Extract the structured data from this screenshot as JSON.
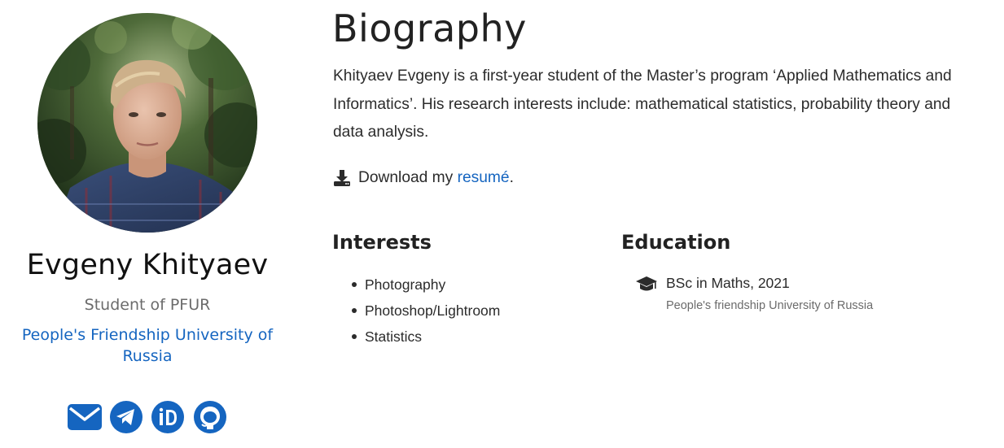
{
  "profile": {
    "name": "Evgeny Khityaev",
    "role": "Student of PFUR",
    "organization": "People's Friendship University of Russia",
    "avatar_icon": "profile-photo",
    "social": [
      {
        "icon": "envelope-icon",
        "label": "email"
      },
      {
        "icon": "telegram-icon",
        "label": "telegram"
      },
      {
        "icon": "orcid-icon",
        "label": "orcid"
      },
      {
        "icon": "github-icon",
        "label": "github"
      }
    ]
  },
  "biography": {
    "title": "Biography",
    "text": "Khityaev Evgeny is a first-year student of the Master’s program ‘Applied Mathematics and Informatics’. His research interests include: mathematical statistics, probability theory and data analysis.",
    "download_prefix": "Download my ",
    "download_link": "resumé",
    "download_suffix": "."
  },
  "interests": {
    "title": "Interests",
    "items": [
      "Photography",
      "Photoshop/Lightroom",
      "Statistics"
    ]
  },
  "education": {
    "title": "Education",
    "items": [
      {
        "degree": "BSc in Maths, 2021",
        "institution": "People's friendship University of Russia"
      }
    ]
  },
  "colors": {
    "link": "#1565c0",
    "text": "#2b2b2b",
    "muted": "#6b6b6b"
  }
}
